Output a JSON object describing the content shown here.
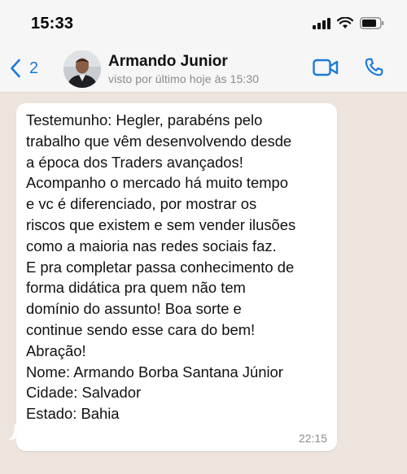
{
  "status_bar": {
    "time": "15:33",
    "icons": [
      "signal-icon",
      "wifi-icon",
      "battery-icon"
    ]
  },
  "header": {
    "back_count": "2",
    "contact_name": "Armando Junior",
    "last_seen": "visto por último hoje às 15:30",
    "icons": [
      "chevron-left-icon",
      "video-camera-icon",
      "phone-icon"
    ]
  },
  "message": {
    "text": "Testemunho: Hegler, parabéns pelo\ntrabalho que vêm desenvolvendo desde\na época dos Traders avançados!\nAcompanho o mercado há muito tempo\ne vc é diferenciado, por mostrar os\nriscos que existem e sem vender ilusões\ncomo a maioria nas redes sociais faz.\nE pra completar passa conhecimento de\nforma didática pra quem não tem\ndomínio do assunto! Boa sorte e\ncontinue sendo esse cara do bem!\nAbração!\nNome: Armando Borba Santana Júnior\nCidade: Salvador\nEstado: Bahia",
    "time": "22:15"
  },
  "colors": {
    "accent": "#1a7ad8",
    "chat_background": "#ede5dd",
    "bar_background": "#f6f6f6",
    "bubble": "#ffffff"
  }
}
